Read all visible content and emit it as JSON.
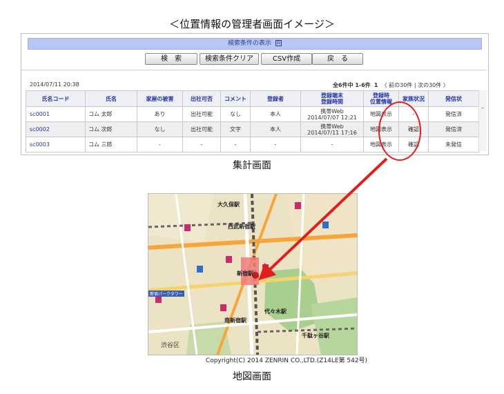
{
  "title": "＜位置情報の管理者画面イメージ＞",
  "search_bar": {
    "label": "検索条件の表示",
    "toggle": "⊟"
  },
  "buttons": {
    "search": "検　索",
    "clear": "検索条件クリア",
    "csv": "CSV作成",
    "back": "戻　る"
  },
  "timestamp": "2014/07/11 20:38",
  "pager": {
    "count": "全6件中 1-6件",
    "page": "1",
    "nav": "〈 前の30件 | 次の30件 〉"
  },
  "columns": [
    "氏名コード",
    "氏名",
    "家屋の被害",
    "出社可否",
    "コメント",
    "登録者",
    "登録端末\n登録時間",
    "登録時\n位置情報",
    "家族状況",
    "発信状"
  ],
  "rows": [
    {
      "code": "sc0001",
      "name": "コム 太郎",
      "damage": "あり",
      "attend": "出社可能",
      "comment": "なし",
      "registrant": "本人",
      "device": "携帯Web",
      "time": "2014/07/07 12:21",
      "location": "地図表示",
      "family": "-",
      "send": "発信済"
    },
    {
      "code": "sc0002",
      "name": "コム 次郎",
      "damage": "なし",
      "attend": "出社可能",
      "comment": "文字",
      "registrant": "本人",
      "device": "携帯Web",
      "time": "2014/07/11 17:16",
      "location": "地図表示",
      "family": "確認",
      "send": "発信済"
    },
    {
      "code": "sc0003",
      "name": "コム 三郎",
      "damage": "-",
      "attend": "-",
      "comment": "-",
      "registrant": "-",
      "device": "-",
      "time": "",
      "location": "地図表示",
      "family": "確認",
      "send": "未発信"
    }
  ],
  "caption_top": "集計画面",
  "map": {
    "labels": {
      "okubo": "大久保駅",
      "seibu": "西武新宿駅",
      "shinjuku": "新宿駅",
      "yoyogi": "代々木駅",
      "minamishinjuku": "南新宿駅",
      "sendagaya": "千駄ヶ谷駅",
      "shibuya": "渋谷区",
      "park": "新宿パークタワー"
    }
  },
  "copyright": "Copyright(C) 2014 ZENRIN CO.,LTD.(Z14LE第 542号)",
  "caption_bottom": "地図画面",
  "colors": {
    "link": "#2233aa",
    "highlight": "#e31c1c",
    "header_bar": "#b8c6f2"
  }
}
